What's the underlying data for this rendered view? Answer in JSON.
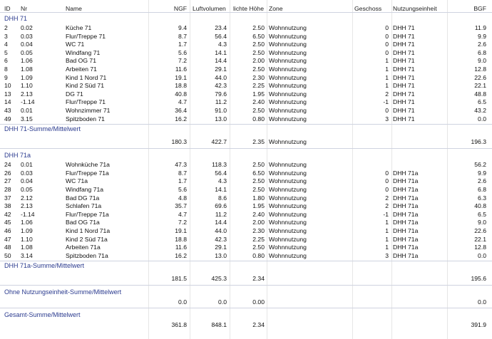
{
  "headers": {
    "id": "ID",
    "nr": "Nr",
    "name": "Name",
    "ngf": "NGF",
    "luft": "Luftvolumen",
    "hoehe": "lichte Höhe",
    "zone": "Zone",
    "geschoss": "Geschoss",
    "nutz": "Nutzungseinheit",
    "bgf": "BGF"
  },
  "groups": [
    {
      "title": "DHH 71",
      "rows": [
        {
          "id": "2",
          "nr": "0.02",
          "name": "Küche 71",
          "ngf": "9.4",
          "luft": "23.4",
          "hoehe": "2.50",
          "zone": "Wohnnutzung",
          "geschoss": "0",
          "nutz": "DHH 71",
          "bgf": "11.9"
        },
        {
          "id": "3",
          "nr": "0.03",
          "name": "Flur/Treppe 71",
          "ngf": "8.7",
          "luft": "56.4",
          "hoehe": "6.50",
          "zone": "Wohnnutzung",
          "geschoss": "0",
          "nutz": "DHH 71",
          "bgf": "9.9"
        },
        {
          "id": "4",
          "nr": "0.04",
          "name": "WC 71",
          "ngf": "1.7",
          "luft": "4.3",
          "hoehe": "2.50",
          "zone": "Wohnnutzung",
          "geschoss": "0",
          "nutz": "DHH 71",
          "bgf": "2.6"
        },
        {
          "id": "5",
          "nr": "0.05",
          "name": "Windfang 71",
          "ngf": "5.6",
          "luft": "14.1",
          "hoehe": "2.50",
          "zone": "Wohnnutzung",
          "geschoss": "0",
          "nutz": "DHH 71",
          "bgf": "6.8"
        },
        {
          "id": "6",
          "nr": "1.06",
          "name": "Bad OG 71",
          "ngf": "7.2",
          "luft": "14.4",
          "hoehe": "2.00",
          "zone": "Wohnnutzung",
          "geschoss": "1",
          "nutz": "DHH 71",
          "bgf": "9.0"
        },
        {
          "id": "8",
          "nr": "1.08",
          "name": "Arbeiten 71",
          "ngf": "11.6",
          "luft": "29.1",
          "hoehe": "2.50",
          "zone": "Wohnnutzung",
          "geschoss": "1",
          "nutz": "DHH 71",
          "bgf": "12.8"
        },
        {
          "id": "9",
          "nr": "1.09",
          "name": "Kind 1 Nord 71",
          "ngf": "19.1",
          "luft": "44.0",
          "hoehe": "2.30",
          "zone": "Wohnnutzung",
          "geschoss": "1",
          "nutz": "DHH 71",
          "bgf": "22.6"
        },
        {
          "id": "10",
          "nr": "1.10",
          "name": "Kind 2 Süd 71",
          "ngf": "18.8",
          "luft": "42.3",
          "hoehe": "2.25",
          "zone": "Wohnnutzung",
          "geschoss": "1",
          "nutz": "DHH 71",
          "bgf": "22.1"
        },
        {
          "id": "13",
          "nr": "2.13",
          "name": "DG 71",
          "ngf": "40.8",
          "luft": "79.6",
          "hoehe": "1.95",
          "zone": "Wohnnutzung",
          "geschoss": "2",
          "nutz": "DHH 71",
          "bgf": "48.8"
        },
        {
          "id": "14",
          "nr": "-1.14",
          "name": "Flur/Treppe 71",
          "ngf": "4.7",
          "luft": "11.2",
          "hoehe": "2.40",
          "zone": "Wohnnutzung",
          "geschoss": "-1",
          "nutz": "DHH 71",
          "bgf": "6.5"
        },
        {
          "id": "43",
          "nr": "0.01",
          "name": "Wohnzimmer 71",
          "ngf": "36.4",
          "luft": "91.0",
          "hoehe": "2.50",
          "zone": "Wohnnutzung",
          "geschoss": "0",
          "nutz": "DHH 71",
          "bgf": "43.2"
        },
        {
          "id": "49",
          "nr": "3.15",
          "name": "Spitzboden 71",
          "ngf": "16.2",
          "luft": "13.0",
          "hoehe": "0.80",
          "zone": "Wohnnutzung",
          "geschoss": "3",
          "nutz": "DHH 71",
          "bgf": "0.0"
        }
      ],
      "summary_label": "DHH 71-Summe/Mittelwert",
      "summary": {
        "ngf": "180.3",
        "luft": "422.7",
        "hoehe": "2.35",
        "zone": "Wohnnutzung",
        "bgf": "196.3"
      }
    },
    {
      "title": "DHH 71a",
      "rows": [
        {
          "id": "24",
          "nr": "0.01",
          "name": "Wohnküche 71a",
          "ngf": "47.3",
          "luft": "118.3",
          "hoehe": "2.50",
          "zone": "Wohnnutzung",
          "geschoss": "",
          "nutz": "",
          "bgf": "56.2"
        },
        {
          "id": "26",
          "nr": "0.03",
          "name": "Flur/Treppe 71a",
          "ngf": "8.7",
          "luft": "56.4",
          "hoehe": "6.50",
          "zone": "Wohnnutzung",
          "geschoss": "0",
          "nutz": "DHH 71a",
          "bgf": "9.9"
        },
        {
          "id": "27",
          "nr": "0.04",
          "name": "WC 71a",
          "ngf": "1.7",
          "luft": "4.3",
          "hoehe": "2.50",
          "zone": "Wohnnutzung",
          "geschoss": "0",
          "nutz": "DHH 71a",
          "bgf": "2.6"
        },
        {
          "id": "28",
          "nr": "0.05",
          "name": "Windfang 71a",
          "ngf": "5.6",
          "luft": "14.1",
          "hoehe": "2.50",
          "zone": "Wohnnutzung",
          "geschoss": "0",
          "nutz": "DHH 71a",
          "bgf": "6.8"
        },
        {
          "id": "37",
          "nr": "2.12",
          "name": "Bad DG 71a",
          "ngf": "4.8",
          "luft": "8.6",
          "hoehe": "1.80",
          "zone": "Wohnnutzung",
          "geschoss": "2",
          "nutz": "DHH 71a",
          "bgf": "6.3"
        },
        {
          "id": "38",
          "nr": "2.13",
          "name": "Schlafen 71a",
          "ngf": "35.7",
          "luft": "69.6",
          "hoehe": "1.95",
          "zone": "Wohnnutzung",
          "geschoss": "2",
          "nutz": "DHH 71a",
          "bgf": "40.8"
        },
        {
          "id": "42",
          "nr": "-1.14",
          "name": "Flur/Treppe 71a",
          "ngf": "4.7",
          "luft": "11.2",
          "hoehe": "2.40",
          "zone": "Wohnnutzung",
          "geschoss": "-1",
          "nutz": "DHH 71a",
          "bgf": "6.5"
        },
        {
          "id": "45",
          "nr": "1.06",
          "name": "Bad OG 71a",
          "ngf": "7.2",
          "luft": "14.4",
          "hoehe": "2.00",
          "zone": "Wohnnutzung",
          "geschoss": "1",
          "nutz": "DHH 71a",
          "bgf": "9.0"
        },
        {
          "id": "46",
          "nr": "1.09",
          "name": "Kind 1 Nord 71a",
          "ngf": "19.1",
          "luft": "44.0",
          "hoehe": "2.30",
          "zone": "Wohnnutzung",
          "geschoss": "1",
          "nutz": "DHH 71a",
          "bgf": "22.6"
        },
        {
          "id": "47",
          "nr": "1.10",
          "name": "Kind 2 Süd 71a",
          "ngf": "18.8",
          "luft": "42.3",
          "hoehe": "2.25",
          "zone": "Wohnnutzung",
          "geschoss": "1",
          "nutz": "DHH 71a",
          "bgf": "22.1"
        },
        {
          "id": "48",
          "nr": "1.08",
          "name": "Arbeiten 71a",
          "ngf": "11.6",
          "luft": "29.1",
          "hoehe": "2.50",
          "zone": "Wohnnutzung",
          "geschoss": "1",
          "nutz": "DHH 71a",
          "bgf": "12.8"
        },
        {
          "id": "50",
          "nr": "3.14",
          "name": "Spitzboden 71a",
          "ngf": "16.2",
          "luft": "13.0",
          "hoehe": "0.80",
          "zone": "Wohnnutzung",
          "geschoss": "3",
          "nutz": "DHH 71a",
          "bgf": "0.0"
        }
      ],
      "summary_label": "DHH 71a-Summe/Mittelwert",
      "summary": {
        "ngf": "181.5",
        "luft": "425.3",
        "hoehe": "2.34",
        "zone": "",
        "bgf": "195.6"
      }
    }
  ],
  "ohne": {
    "label": "Ohne Nutzungseinheit-Summe/Mittelwert",
    "ngf": "0.0",
    "luft": "0.0",
    "hoehe": "0.00",
    "bgf": "0.0"
  },
  "gesamt": {
    "label": "Gesamt-Summe/Mittelwert",
    "ngf": "361.8",
    "luft": "848.1",
    "hoehe": "2.34",
    "bgf": "391.9"
  }
}
